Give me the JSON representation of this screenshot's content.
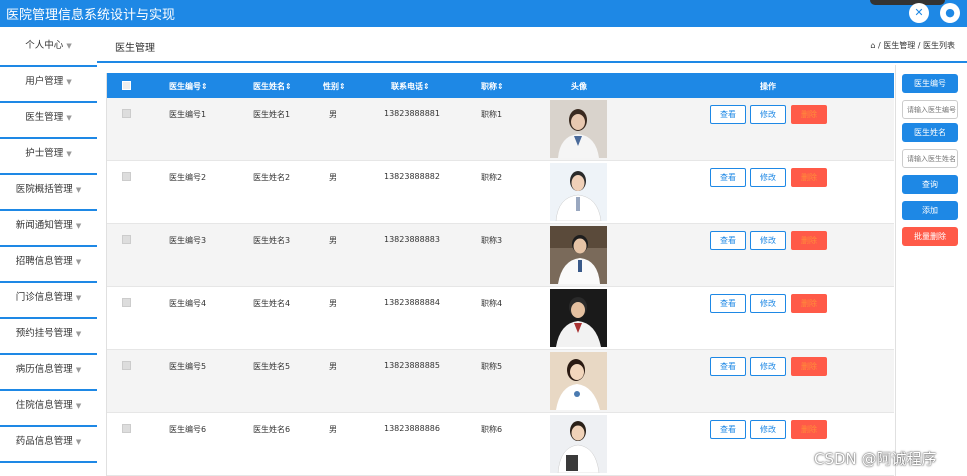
{
  "app": {
    "title": "医院管理信息系统设计与实现"
  },
  "sidebar": {
    "items": [
      {
        "label": "个人中心"
      },
      {
        "label": "用户管理"
      },
      {
        "label": "医生管理"
      },
      {
        "label": "护士管理"
      },
      {
        "label": "医院概括管理"
      },
      {
        "label": "新闻通知管理"
      },
      {
        "label": "招聘信息管理"
      },
      {
        "label": "门诊信息管理"
      },
      {
        "label": "预约挂号管理"
      },
      {
        "label": "病历信息管理"
      },
      {
        "label": "住院信息管理"
      },
      {
        "label": "药品信息管理"
      }
    ]
  },
  "breadcrumb": {
    "section": "医生管理",
    "path": "医生管理 / 医生列表"
  },
  "table": {
    "headers": {
      "id": "医生编号",
      "name": "医生姓名",
      "gender": "性别",
      "phone": "联系电话",
      "title": "职称",
      "avatar": "头像",
      "ops": "操作"
    },
    "rows": [
      {
        "id": "医生编号1",
        "name": "医生姓名1",
        "gender": "男",
        "phone": "13823888881",
        "title": "职称1"
      },
      {
        "id": "医生编号2",
        "name": "医生姓名2",
        "gender": "男",
        "phone": "13823888882",
        "title": "职称2"
      },
      {
        "id": "医生编号3",
        "name": "医生姓名3",
        "gender": "男",
        "phone": "13823888883",
        "title": "职称3"
      },
      {
        "id": "医生编号4",
        "name": "医生姓名4",
        "gender": "男",
        "phone": "13823888884",
        "title": "职称4"
      },
      {
        "id": "医生编号5",
        "name": "医生姓名5",
        "gender": "男",
        "phone": "13823888885",
        "title": "职称5"
      },
      {
        "id": "医生编号6",
        "name": "医生姓名6",
        "gender": "男",
        "phone": "13823888886",
        "title": "职称6"
      }
    ],
    "actions": {
      "view": "查看",
      "edit": "修改",
      "delete": "删除"
    }
  },
  "search": {
    "label_id": "医生编号",
    "placeholder_id": "请输入医生编号",
    "label_name": "医生姓名",
    "placeholder_name": "请输入医生姓名",
    "query_label": "查询",
    "add_label": "添加",
    "batch_delete_label": "批量删除"
  },
  "colors": {
    "primary": "#1e88e5",
    "danger": "#ff5a48"
  },
  "watermark": "CSDN @阿诚程序"
}
